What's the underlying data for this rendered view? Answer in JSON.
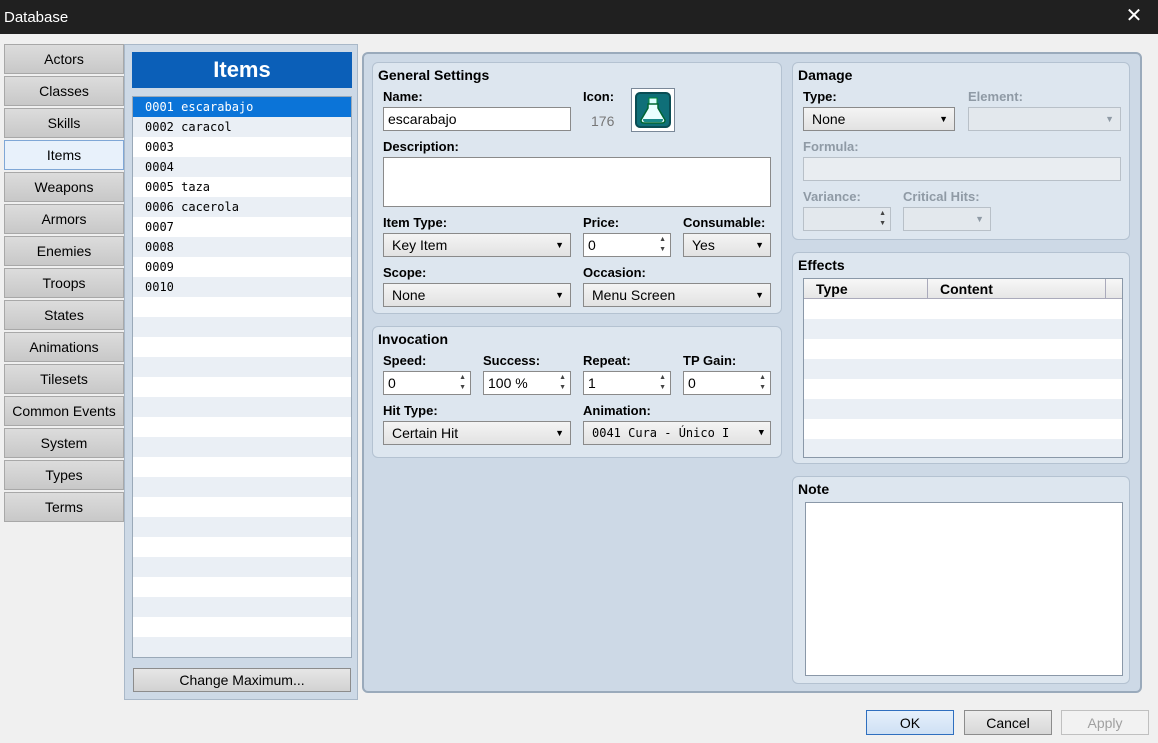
{
  "window": {
    "title": "Database"
  },
  "tabs": [
    "Actors",
    "Classes",
    "Skills",
    "Items",
    "Weapons",
    "Armors",
    "Enemies",
    "Troops",
    "States",
    "Animations",
    "Tilesets",
    "Common Events",
    "System",
    "Types",
    "Terms"
  ],
  "active_tab": "Items",
  "list": {
    "header": "Items",
    "items": [
      "0001 escarabajo",
      "0002 caracol",
      "0003",
      "0004",
      "0005 taza",
      "0006 cacerola",
      "0007",
      "0008",
      "0009",
      "0010"
    ],
    "selected_index": 0,
    "change_max_label": "Change Maximum..."
  },
  "general": {
    "title": "General Settings",
    "name_label": "Name:",
    "name_value": "escarabajo",
    "icon_label": "Icon:",
    "icon_index": "176",
    "description_label": "Description:",
    "description_value": "",
    "item_type_label": "Item Type:",
    "item_type_value": "Key Item",
    "price_label": "Price:",
    "price_value": "0",
    "consumable_label": "Consumable:",
    "consumable_value": "Yes",
    "scope_label": "Scope:",
    "scope_value": "None",
    "occasion_label": "Occasion:",
    "occasion_value": "Menu Screen"
  },
  "invocation": {
    "title": "Invocation",
    "speed_label": "Speed:",
    "speed_value": "0",
    "success_label": "Success:",
    "success_value": "100 %",
    "repeat_label": "Repeat:",
    "repeat_value": "1",
    "tp_label": "TP Gain:",
    "tp_value": "0",
    "hit_type_label": "Hit Type:",
    "hit_type_value": "Certain Hit",
    "animation_label": "Animation:",
    "animation_value": "0041 Cura - Único I"
  },
  "damage": {
    "title": "Damage",
    "type_label": "Type:",
    "type_value": "None",
    "element_label": "Element:",
    "formula_label": "Formula:",
    "variance_label": "Variance:",
    "critical_label": "Critical Hits:"
  },
  "effects": {
    "title": "Effects",
    "columns": [
      "Type",
      "Content"
    ]
  },
  "note": {
    "title": "Note"
  },
  "buttons": {
    "ok": "OK",
    "cancel": "Cancel",
    "apply": "Apply"
  }
}
